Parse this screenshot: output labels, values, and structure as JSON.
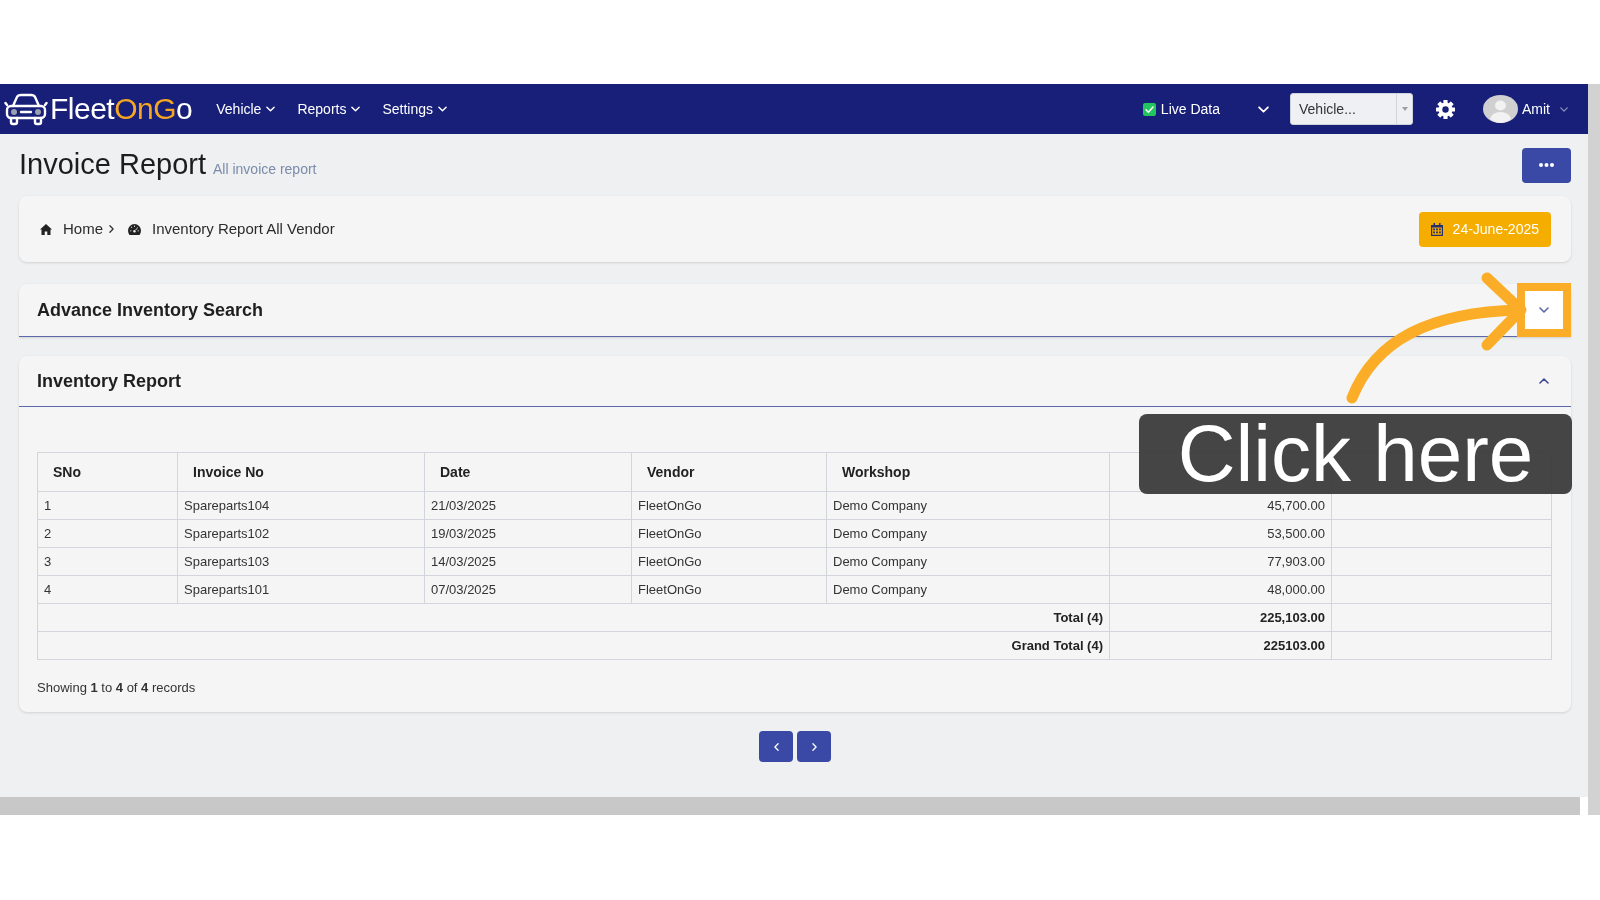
{
  "navbar": {
    "logo_parts": [
      "Fleet",
      "OnG",
      "o"
    ],
    "menu": [
      "Vehicle",
      "Reports",
      "Settings"
    ],
    "live_data": {
      "label": "Live Data",
      "checked": true
    },
    "vehicle_select": {
      "value": "Vehicle..."
    },
    "user": {
      "name": "Amit"
    }
  },
  "page_header": {
    "title": "Invoice Report",
    "subtitle": "All invoice report"
  },
  "breadcrumb": {
    "items": [
      "Home",
      "Inventory Report All Vendor"
    ],
    "date": "24-June-2025"
  },
  "search_panel": {
    "title": "Advance Inventory Search",
    "expanded": false,
    "highlighted": true
  },
  "report_panel": {
    "title": "Inventory Report",
    "expanded": true,
    "table": {
      "columns": [
        "SNo",
        "Invoice No",
        "Date",
        "Vendor",
        "Workshop"
      ],
      "rows": [
        {
          "sno": "1",
          "invoice_no": "Spareparts104",
          "date": "21/03/2025",
          "vendor": "FleetOnGo",
          "workshop": "Demo Company",
          "column_6": "45,700.00"
        },
        {
          "sno": "2",
          "invoice_no": "Spareparts102",
          "date": "19/03/2025",
          "vendor": "FleetOnGo",
          "workshop": "Demo Company",
          "column_6": "53,500.00"
        },
        {
          "sno": "3",
          "invoice_no": "Spareparts103",
          "date": "14/03/2025",
          "vendor": "FleetOnGo",
          "workshop": "Demo Company",
          "column_6": "77,903.00"
        },
        {
          "sno": "4",
          "invoice_no": "Spareparts101",
          "date": "07/03/2025",
          "vendor": "FleetOnGo",
          "workshop": "Demo Company",
          "column_6": "48,000.00"
        }
      ],
      "totals": [
        {
          "label": "Total (4)",
          "value": "225,103.00"
        },
        {
          "label": "Grand Total (4)",
          "value": "225103.00"
        }
      ]
    },
    "summary": "Showing **1** to **4** of **4** records"
  },
  "annotation": {
    "text": "Click here"
  }
}
